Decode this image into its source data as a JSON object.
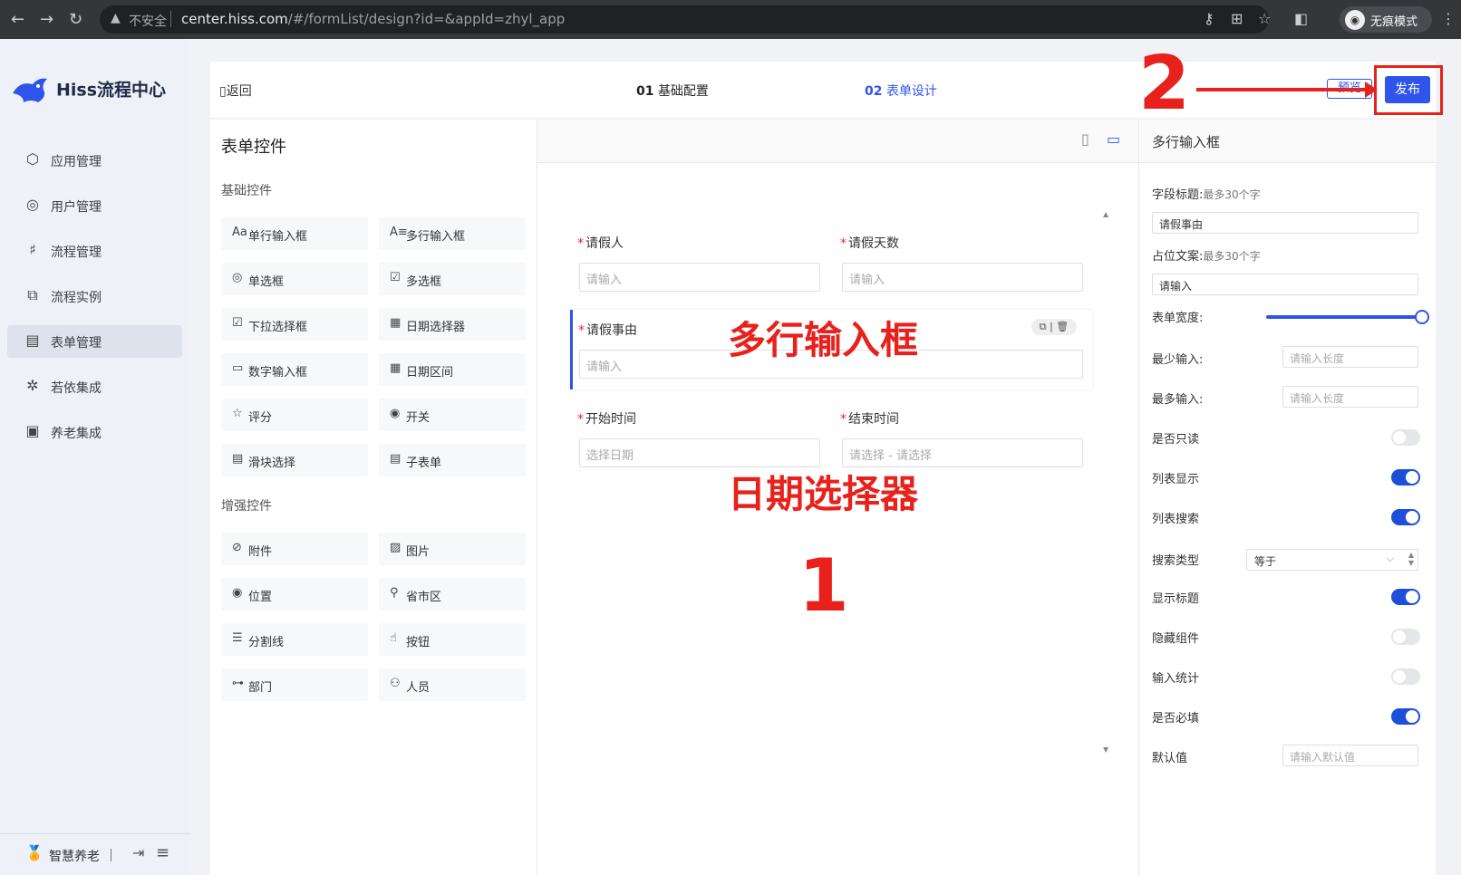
{
  "browser": {
    "warning_text": "不安全",
    "url_host": "center.hiss.com",
    "url_rest": "/#/formList/design?id=&appId=zhyl_app",
    "incognito_label": "无痕模式"
  },
  "sidebar": {
    "logo_text": "Hiss流程中心",
    "items": [
      {
        "label": "应用管理",
        "icon": "cube-icon"
      },
      {
        "label": "用户管理",
        "icon": "user-icon"
      },
      {
        "label": "流程管理",
        "icon": "flow-icon"
      },
      {
        "label": "流程实例",
        "icon": "instance-icon"
      },
      {
        "label": "表单管理",
        "icon": "form-icon",
        "active": true
      },
      {
        "label": "若依集成",
        "icon": "integration-icon"
      },
      {
        "label": "养老集成",
        "icon": "elderly-icon"
      }
    ],
    "footer_label": "智慧养老"
  },
  "header": {
    "back_label": "返回",
    "step1_num": "01",
    "step1_label": "基础配置",
    "step2_num": "02",
    "step2_label": "表单设计",
    "preview_label": "预览",
    "publish_label": "发布"
  },
  "controls": {
    "title": "表单控件",
    "basic_title": "基础控件",
    "basic": [
      {
        "label": "单行输入框",
        "icon": "text-icon"
      },
      {
        "label": "多行输入框",
        "icon": "textarea-icon"
      },
      {
        "label": "单选框",
        "icon": "radio-icon"
      },
      {
        "label": "多选框",
        "icon": "checkbox-icon"
      },
      {
        "label": "下拉选择框",
        "icon": "select-icon"
      },
      {
        "label": "日期选择器",
        "icon": "calendar-icon"
      },
      {
        "label": "数字输入框",
        "icon": "number-icon"
      },
      {
        "label": "日期区间",
        "icon": "date-range-icon"
      },
      {
        "label": "评分",
        "icon": "star-icon"
      },
      {
        "label": "开关",
        "icon": "switch-icon"
      },
      {
        "label": "滑块选择",
        "icon": "slider-icon"
      },
      {
        "label": "子表单",
        "icon": "subform-icon"
      }
    ],
    "enhanced_title": "增强控件",
    "enhanced": [
      {
        "label": "附件",
        "icon": "attachment-icon"
      },
      {
        "label": "图片",
        "icon": "image-icon"
      },
      {
        "label": "位置",
        "icon": "location-icon"
      },
      {
        "label": "省市区",
        "icon": "region-icon"
      },
      {
        "label": "分割线",
        "icon": "divider-icon"
      },
      {
        "label": "按钮",
        "icon": "hand-icon"
      },
      {
        "label": "部门",
        "icon": "department-icon"
      },
      {
        "label": "人员",
        "icon": "people-icon"
      }
    ]
  },
  "canvas": {
    "fields": [
      {
        "label": "请假人",
        "placeholder": "请输入"
      },
      {
        "label": "请假天数",
        "placeholder": "请输入"
      },
      {
        "label": "请假事由",
        "placeholder": "请输入"
      },
      {
        "label": "开始时间",
        "placeholder": "选择日期"
      },
      {
        "label": "结束时间",
        "placeholder": "请选择 - 请选择"
      }
    ],
    "required_mark": "*",
    "annotations": {
      "textarea": "多行输入框",
      "datepicker": "日期选择器",
      "num1": "1",
      "num2": "2"
    }
  },
  "props": {
    "title": "多行输入框",
    "field_title_label": "字段标题:",
    "field_title_hint": "最多30个字",
    "field_title_value": "请假事由",
    "placeholder_label": "占位文案:",
    "placeholder_hint": "最多30个字",
    "placeholder_value": "请输入",
    "width_label": "表单宽度:",
    "width_value": 1.0,
    "min_label": "最少输入:",
    "min_placeholder": "请输入长度",
    "max_label": "最多输入:",
    "max_placeholder": "请输入长度",
    "readonly_label": "是否只读",
    "readonly": false,
    "list_show_label": "列表显示",
    "list_show": true,
    "list_search_label": "列表搜索",
    "list_search": true,
    "search_type_label": "搜索类型",
    "search_type_value": "等于",
    "show_title_label": "显示标题",
    "show_title": true,
    "hide_label": "隐藏组件",
    "hide": false,
    "count_label": "输入统计",
    "count": false,
    "required_label": "是否必填",
    "required": true,
    "default_label": "默认值",
    "default_placeholder": "请输入默认值"
  }
}
